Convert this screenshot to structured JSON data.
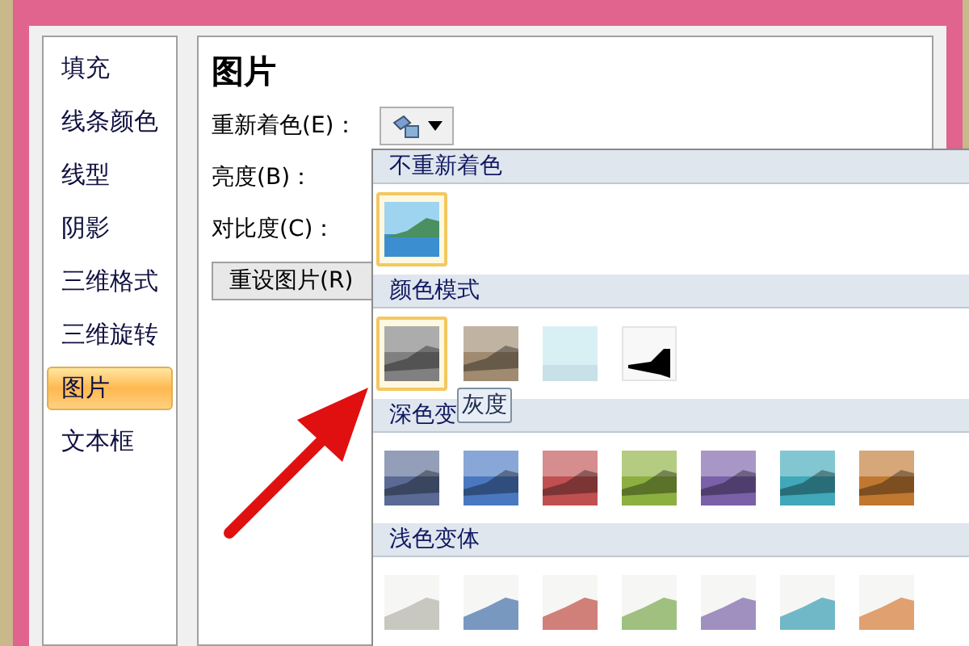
{
  "sidebar": {
    "items": [
      {
        "label": "填充",
        "selected": false
      },
      {
        "label": "线条颜色",
        "selected": false
      },
      {
        "label": "线型",
        "selected": false
      },
      {
        "label": "阴影",
        "selected": false
      },
      {
        "label": "三维格式",
        "selected": false
      },
      {
        "label": "三维旋转",
        "selected": false
      },
      {
        "label": "图片",
        "selected": true
      },
      {
        "label": "文本框",
        "selected": false
      }
    ]
  },
  "panel": {
    "heading": "图片",
    "recolor_label": "重新着色(E)：",
    "brightness_label": "亮度(B)：",
    "contrast_label": "对比度(C)：",
    "reset_button": "重设图片(R)"
  },
  "recolor_menu": {
    "sections": [
      {
        "title": "不重新着色",
        "swatches": [
          {
            "kind": "photo",
            "color": "#3b8fd0",
            "selected": true
          }
        ]
      },
      {
        "title": "颜色模式",
        "swatches": [
          {
            "kind": "tint",
            "color": "#808080",
            "selected": true
          },
          {
            "kind": "tint",
            "color": "#a08a70",
            "selected": false
          },
          {
            "kind": "washout",
            "color": "#d8f0f4",
            "selected": false
          },
          {
            "kind": "blackwhite",
            "color": "#000000",
            "selected": false
          }
        ]
      },
      {
        "title": "深色变",
        "swatches": [
          {
            "kind": "tint",
            "color": "#5a6a94",
            "selected": false
          },
          {
            "kind": "tint",
            "color": "#4a78c0",
            "selected": false
          },
          {
            "kind": "tint",
            "color": "#c05050",
            "selected": false
          },
          {
            "kind": "tint",
            "color": "#8cb040",
            "selected": false
          },
          {
            "kind": "tint",
            "color": "#7a60a8",
            "selected": false
          },
          {
            "kind": "tint",
            "color": "#40a8b8",
            "selected": false
          },
          {
            "kind": "tint",
            "color": "#c07830",
            "selected": false
          }
        ]
      },
      {
        "title": "浅色变体",
        "swatches": [
          {
            "kind": "light",
            "color": "#c8c8c0",
            "selected": false
          },
          {
            "kind": "light",
            "color": "#7898c0",
            "selected": false
          },
          {
            "kind": "light",
            "color": "#d08078",
            "selected": false
          },
          {
            "kind": "light",
            "color": "#a0c080",
            "selected": false
          },
          {
            "kind": "light",
            "color": "#a090c0",
            "selected": false
          },
          {
            "kind": "light",
            "color": "#70b8c8",
            "selected": false
          },
          {
            "kind": "light",
            "color": "#e0a070",
            "selected": false
          }
        ]
      }
    ]
  },
  "tooltip": "灰度"
}
